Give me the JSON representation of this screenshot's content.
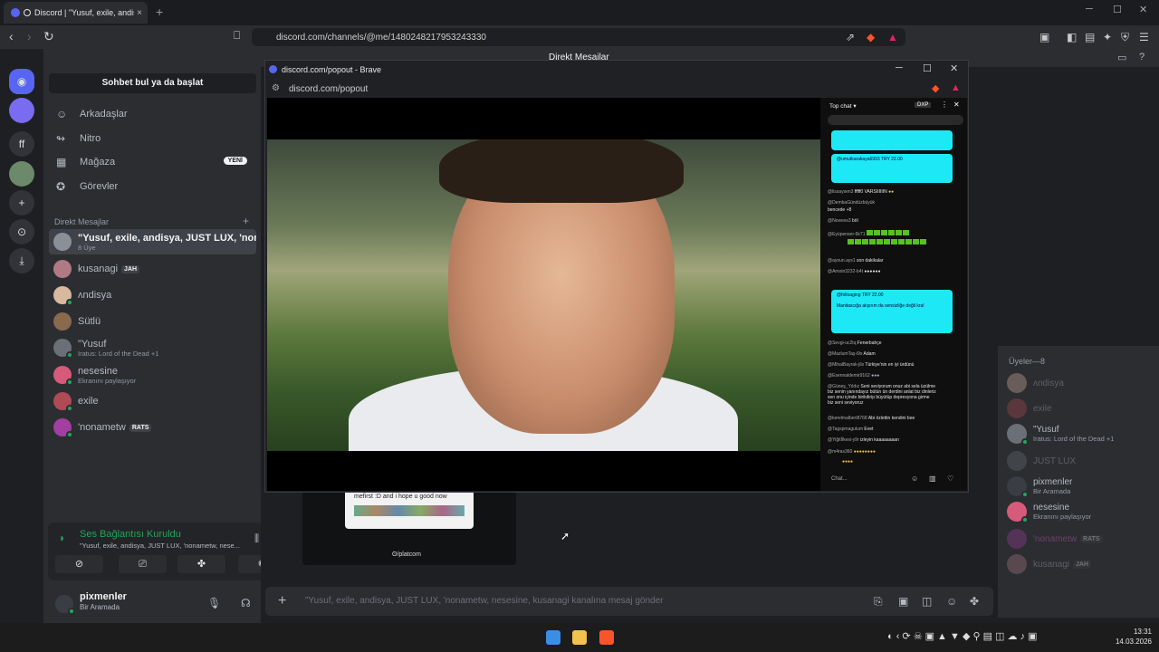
{
  "browser": {
    "tab_title": "Discord | \"Yusuf, exile, andisya",
    "tab_close": "×",
    "new_tab": "+",
    "url": "discord.com/channels/@me/1480248217953243330"
  },
  "servers": {
    "short_label": "ff"
  },
  "sidebar": {
    "search_label": "Sohbet bul ya da başlat",
    "nav": [
      {
        "label": "Arkadaşlar"
      },
      {
        "label": "Nitro"
      },
      {
        "label": "Mağaza",
        "badge": "YENİ"
      },
      {
        "label": "Görevler"
      }
    ],
    "dm_header": "Direkt Mesajlar",
    "dm_add": "+",
    "dms": [
      {
        "name": "\"Yusuf, exile, andisya, JUST LUX, 'nona...",
        "sub": "8 Üye"
      },
      {
        "name": "kusanagi",
        "tag": "JAH"
      },
      {
        "name": "ᴧndisya"
      },
      {
        "name": "Sütlü"
      },
      {
        "name": "\"Yusuf",
        "sub": "Iratus: Lord of the Dead +1"
      },
      {
        "name": "nesesine",
        "sub": "Ekranını paylaşıyor"
      },
      {
        "name": "exile"
      },
      {
        "name": "'nonametw",
        "tag": "RATS"
      }
    ]
  },
  "voice": {
    "title": "Ses Bağlantısı Kuruldu",
    "channel": "\"Yusuf, exile, andisya, JUST LUX, 'nonametw, nese..."
  },
  "user": {
    "name": "pixmenler",
    "status": "Bir Aramada"
  },
  "main": {
    "title": "Direkt Mesajlar",
    "message_placeholder": "\"Yusuf, exile, andisya, JUST LUX, 'nonametw, nesesine, kusanagi kanalına mesaj gönder",
    "stream_card_text": "mefirst :D and i hope u good now",
    "stream_watermark": "ʘ/platcom"
  },
  "members": {
    "header": "Üyeler—8",
    "list": [
      {
        "name": "ᴧndisya",
        "offline": true
      },
      {
        "name": "exile",
        "offline": true
      },
      {
        "name": "\"Yusuf",
        "sub": "Iratus: Lord of the Dead +1",
        "offline": false
      },
      {
        "name": "JUST LUX",
        "offline": true
      },
      {
        "name": "pixmenler",
        "sub": "Bir Aramada",
        "offline": false
      },
      {
        "name": "nesesine",
        "sub": "Ekranını paylaşıyor",
        "offline": false
      },
      {
        "name": "'nonametw",
        "tag": "RATS",
        "offline": true
      },
      {
        "name": "kusanagi",
        "tag": "JAH",
        "offline": true
      }
    ]
  },
  "popout": {
    "title": "discord.com/popout - Brave",
    "url": "discord.com/popout",
    "chat": {
      "header": "Top chat",
      "badge": "DXP",
      "input_placeholder": "Chat...",
      "super1_name": "@umutkarakaya6993",
      "super1_amount": "TRY 22.00",
      "super2_name": "@folloaging",
      "super2_amount": "TRY 22.00",
      "super2_text": "Manitascığa alışırım da sensizliğe değil kral",
      "lines": [
        {
          "user": "@lissaysen3",
          "text": "fffff0 VARSIIIIIIN"
        },
        {
          "user": "@DembaGündüzbüyük",
          "text": "bencede +8"
        },
        {
          "user": "@Nowess3",
          "text": "böl"
        },
        {
          "user": "@Eyüpenser-6k71",
          "text": ""
        },
        {
          "user": "@ayoun.ays1",
          "text": "son dakikalar"
        },
        {
          "user": "@Amoin3232-b4t",
          "text": ""
        },
        {
          "user": "@Sevgi-uc2tq",
          "text": "Fenerbahçe"
        },
        {
          "user": "@MazlumTaş-i9x",
          "text": "Adam"
        },
        {
          "user": "@MihalBayrak-jllx",
          "text": "Türkiye'nin en iyi ürdünü"
        },
        {
          "user": "@Esennaldemir9162",
          "text": ""
        },
        {
          "user": "@Güneş_Yıldız",
          "text": "Seni seviyorum onuz abi sela üzülme biz senin yanındayız bütün ün derdini anlat biz dinleriz sen onu içinde birikitirip büyütüp depresyona girme biz seni seviyoruz"
        },
        {
          "user": "@kerelmalbert8768",
          "text": "Abi özlettin kendini bee"
        },
        {
          "user": "@Tagspmagulum",
          "text": "Evet"
        },
        {
          "user": "@Yiğitİlkesi-y9r",
          "text": "izleyin kaaaaaaaan"
        },
        {
          "user": "@m4ras360",
          "text": ""
        }
      ]
    }
  },
  "taskbar": {
    "time": "13:31",
    "date": "14.03.2026"
  }
}
